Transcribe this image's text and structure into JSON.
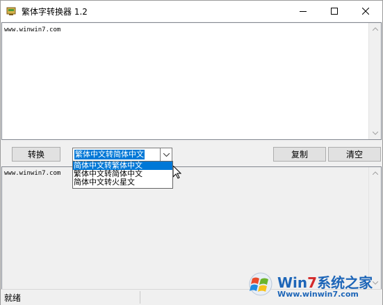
{
  "window": {
    "title": "繁体字转换器 1.2",
    "minimize_icon": "minimize-icon",
    "maximize_icon": "maximize-icon",
    "close_icon": "close-icon"
  },
  "input": {
    "text": "www.winwin7.com"
  },
  "toolbar": {
    "convert_label": "转换",
    "copy_label": "复制",
    "clear_label": "清空",
    "mode_selected": "繁体中文转简体中文"
  },
  "dropdown": {
    "options": [
      "简体中文转繁体中文",
      "繁体中文转简体中文",
      "简体中文转火星文"
    ]
  },
  "output": {
    "text": "www.winwin7.com"
  },
  "status": {
    "text": "就绪"
  },
  "watermark": {
    "main_prefix": "Win",
    "main_digit": "7",
    "main_suffix": "系统之家",
    "sub": "Www.winwin7.com"
  },
  "colors": {
    "accent": "#0078d7",
    "wm_blue": "#1e66b8",
    "wm_red": "#d42a2a"
  }
}
